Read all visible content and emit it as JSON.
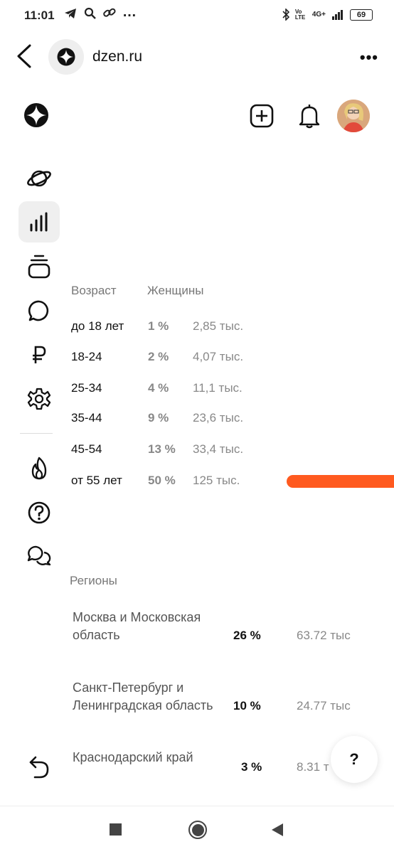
{
  "status_bar": {
    "time": "11:01",
    "more": "…",
    "network": "4G+",
    "volte": "Vo LTE",
    "battery": "69"
  },
  "browser": {
    "site_name": "dzen.ru",
    "more": "•••"
  },
  "age": {
    "header_age": "Возраст",
    "header_women": "Женщины",
    "rows": [
      {
        "label": "до 18 лет",
        "pct": "1 %",
        "value": "2,85 тыс."
      },
      {
        "label": "18-24",
        "pct": "2 %",
        "value": "4,07 тыс."
      },
      {
        "label": "25-34",
        "pct": "4 %",
        "value": "11,1 тыс."
      },
      {
        "label": "35-44",
        "pct": "9 %",
        "value": "23,6 тыс."
      },
      {
        "label": "45-54",
        "pct": "13 %",
        "value": "33,4 тыс."
      },
      {
        "label": "от 55 лет",
        "pct": "50 %",
        "value": "125 тыс."
      }
    ],
    "bar_color": "#ff5a1f"
  },
  "regions": {
    "header": "Регионы",
    "rows": [
      {
        "name": "Москва и Московская область",
        "pct": "26 %",
        "value": "63.72 тыс"
      },
      {
        "name": "Санкт-Петербург и Ленинградская область",
        "pct": "10 %",
        "value": "24.77 тыс"
      },
      {
        "name": "Краснодарский край",
        "pct": "3 %",
        "value": "8.31 т"
      }
    ]
  },
  "help_label": "?",
  "icons": {
    "back": "back-arrow-icon",
    "logo": "dzen-logo-icon",
    "add": "add-square-icon",
    "bell": "bell-icon",
    "explore": "planet-icon",
    "stats": "stats-bars-icon",
    "publications": "stack-icon",
    "comments": "chat-bubble-icon",
    "money": "ruble-icon",
    "settings": "gear-icon",
    "hot": "flame-icon",
    "help": "question-circle-icon",
    "support": "chat-bubbles-icon",
    "undo": "undo-arrow-icon"
  }
}
